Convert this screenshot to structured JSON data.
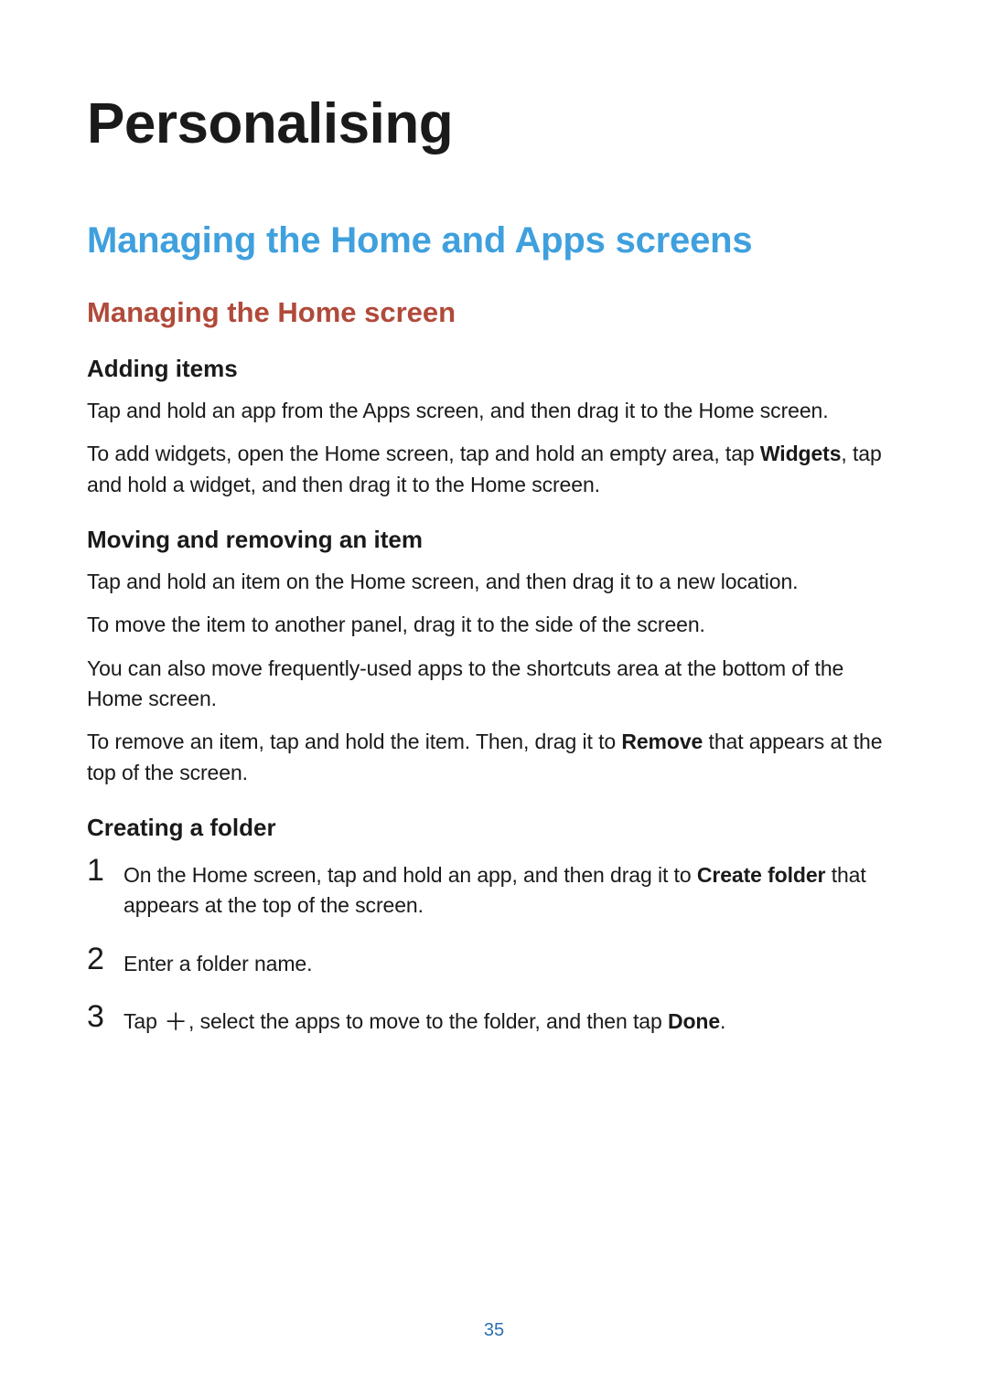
{
  "page": {
    "title": "Personalising",
    "number": "35"
  },
  "h2": "Managing the Home and Apps screens",
  "h3": "Managing the Home screen",
  "sections": {
    "adding": {
      "title": "Adding items",
      "p1": "Tap and hold an app from the Apps screen, and then drag it to the Home screen.",
      "p2a": "To add widgets, open the Home screen, tap and hold an empty area, tap ",
      "p2bold": "Widgets",
      "p2b": ", tap and hold a widget, and then drag it to the Home screen."
    },
    "moving": {
      "title": "Moving and removing an item",
      "p1": "Tap and hold an item on the Home screen, and then drag it to a new location.",
      "p2": "To move the item to another panel, drag it to the side of the screen.",
      "p3": "You can also move frequently-used apps to the shortcuts area at the bottom of the Home screen.",
      "p4a": "To remove an item, tap and hold the item. Then, drag it to ",
      "p4bold": "Remove",
      "p4b": " that appears at the top of the screen."
    },
    "folder": {
      "title": "Creating a folder",
      "steps": [
        {
          "num": "1",
          "a": "On the Home screen, tap and hold an app, and then drag it to ",
          "bold": "Create folder",
          "b": " that appears at the top of the screen."
        },
        {
          "num": "2",
          "text": "Enter a folder name."
        },
        {
          "num": "3",
          "a": "Tap ",
          "b": ", select the apps to move to the folder, and then tap ",
          "bold": "Done",
          "c": "."
        }
      ]
    }
  }
}
